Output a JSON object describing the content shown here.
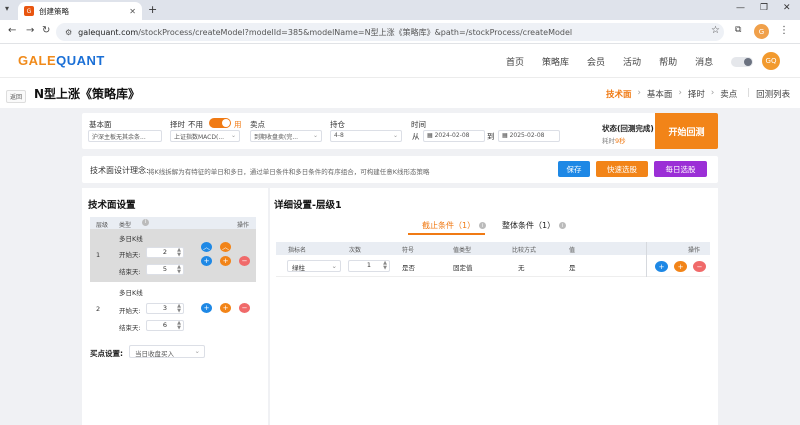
{
  "browser": {
    "tab_title": "创建策略",
    "favicon_glyph": "G",
    "url_host": "galequant.com",
    "url_path": "/stockProcess/createModel?modelId=385&modelName=N型上涨《策略库》&path=/stockProcess/createModel",
    "profile_initials": "G"
  },
  "header": {
    "logo_part1": "GALE",
    "logo_part2": "QUANT",
    "menu": [
      "首页",
      "策略库",
      "会员",
      "活动",
      "帮助",
      "消息"
    ],
    "avatar_initials": "GQ"
  },
  "title_row": {
    "back_label": "返回",
    "page_title": "N型上涨《策略库》",
    "crumbs": [
      "技术面",
      "基本面",
      "择时",
      "卖点"
    ],
    "list_link": "回测列表"
  },
  "filters": {
    "fundamental_label": "基本面",
    "fundamental_value": "沪深主板无其余条...",
    "timing_label": "择时",
    "timing_off": "不用",
    "timing_on": "用",
    "timing_value": "上证指数MACD(...",
    "sell_label": "卖点",
    "sell_value": "到期收盘卖(完...",
    "hold_label": "持仓",
    "hold_value": "4-8",
    "time_label": "时间",
    "time_from_label": "从",
    "date_from": "2024-02-08",
    "time_to_label": "到",
    "date_to": "2025-02-08",
    "status_label": "状态(回测完成)",
    "status_time_prefix": "耗时",
    "status_time_value": "9秒",
    "start_button": "开始回测"
  },
  "concept": {
    "label": "技术面设计理念:",
    "text": "将K线拆解为有特征的单日和多日，通过单日条件和多日条件的有序组合，可构建任意K线形态策略",
    "save": "保存",
    "quick_pick": "快速选股",
    "daily_pick": "每日选股",
    "colors": {
      "save": "#1e88e5",
      "quick_pick": "#f28418",
      "daily_pick": "#9b2fd6"
    }
  },
  "left_panel": {
    "title": "技术面设置",
    "col_level": "层级",
    "col_type": "类型",
    "col_ops": "操作",
    "rows": [
      {
        "level": "1",
        "type": "多日K线",
        "start_label": "开始天:",
        "start": "2",
        "end_label": "结束天:",
        "end": "5"
      },
      {
        "level": "2",
        "type": "多日K线",
        "start_label": "开始天:",
        "start": "3",
        "end_label": "结束天:",
        "end": "6"
      }
    ],
    "buy_label": "买点设置:",
    "buy_value": "当日收盘买入"
  },
  "right_panel": {
    "title": "详细设置-层级1",
    "tab_filter": "截止条件（1）",
    "tab_overall": "整体条件（1）",
    "headers": [
      "指标名",
      "次数",
      "符号",
      "值类型",
      "比较方式",
      "值",
      "操作"
    ],
    "row": {
      "indicator": "绿柱",
      "count": "1",
      "symbol": "是否",
      "value_type": "固定值",
      "compare": "无",
      "value": "是"
    }
  },
  "icons": {
    "up": "chevron-up-icon",
    "add": "plus-icon",
    "remove": "minus-icon",
    "info": "info-icon",
    "calendar": "calendar-icon"
  }
}
